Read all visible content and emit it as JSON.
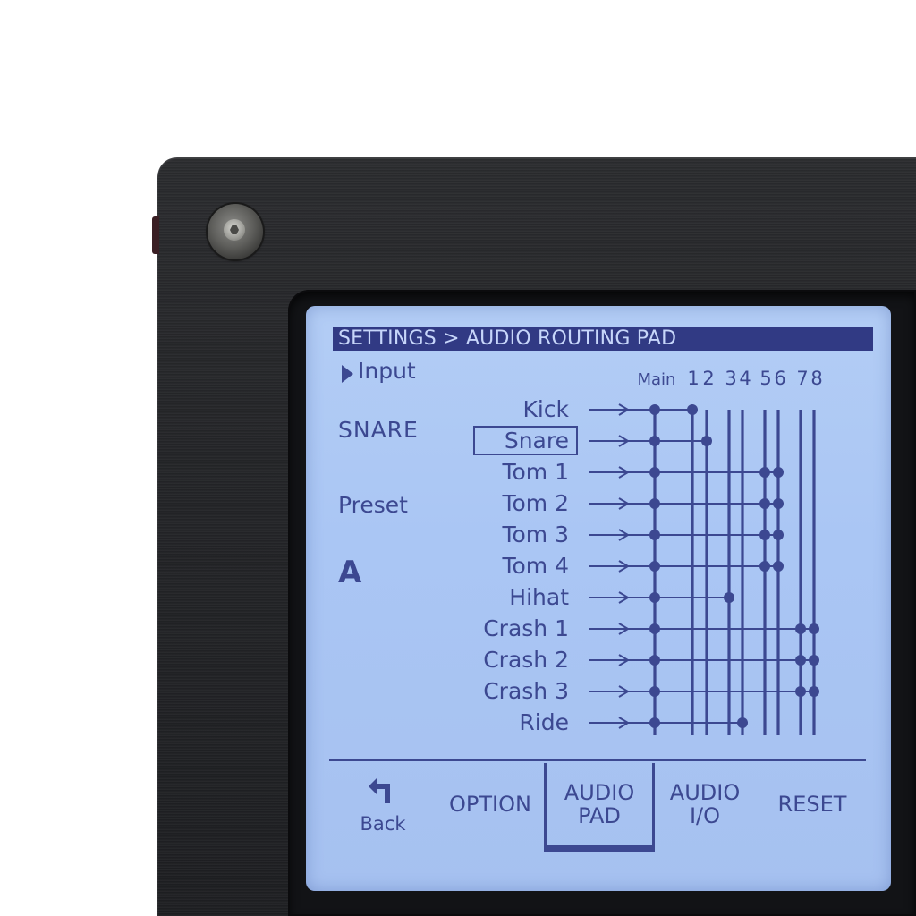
{
  "header": {
    "title": "SETTINGS > AUDIO ROUTING PAD"
  },
  "left_panel": {
    "input_label": "Input",
    "selected_input": "SNARE",
    "preset_label": "Preset",
    "preset_value": "A"
  },
  "routing": {
    "outputs": [
      "Main",
      "1",
      "2",
      "3",
      "4",
      "5",
      "6",
      "7",
      "8"
    ],
    "selected_pad": "Snare",
    "pads": [
      {
        "name": "Kick",
        "routes": [
          "Main",
          "1"
        ]
      },
      {
        "name": "Snare",
        "routes": [
          "Main",
          "2"
        ]
      },
      {
        "name": "Tom 1",
        "routes": [
          "Main",
          "5",
          "6"
        ]
      },
      {
        "name": "Tom 2",
        "routes": [
          "Main",
          "5",
          "6"
        ]
      },
      {
        "name": "Tom 3",
        "routes": [
          "Main",
          "5",
          "6"
        ]
      },
      {
        "name": "Tom 4",
        "routes": [
          "Main",
          "5",
          "6"
        ]
      },
      {
        "name": "Hihat",
        "routes": [
          "Main",
          "3"
        ]
      },
      {
        "name": "Crash 1",
        "routes": [
          "Main",
          "7",
          "8"
        ]
      },
      {
        "name": "Crash 2",
        "routes": [
          "Main",
          "7",
          "8"
        ]
      },
      {
        "name": "Crash 3",
        "routes": [
          "Main",
          "7",
          "8"
        ]
      },
      {
        "name": "Ride",
        "routes": [
          "Main",
          "4"
        ]
      }
    ]
  },
  "tabs": {
    "back_label": "Back",
    "option_label": "OPTION",
    "audio_pad_line1": "AUDIO",
    "audio_pad_line2": "PAD",
    "audio_io_line1": "AUDIO",
    "audio_io_line2": "I/O",
    "reset_label": "RESET",
    "active_tab": "AUDIO PAD"
  },
  "colors": {
    "lcd_background": "#aac6f4",
    "lcd_ink": "#3c4891",
    "title_bar": "#313a84",
    "device_body": "#232427"
  }
}
